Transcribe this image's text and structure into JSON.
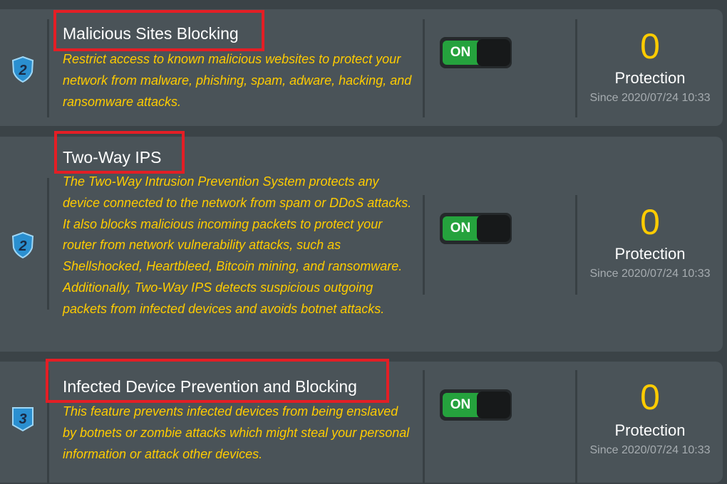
{
  "colors": {
    "card_bg": "#4a5358",
    "page_bg": "#3b4347",
    "title": "#ffffff",
    "description": "#ffcc00",
    "count": "#ffcc00",
    "toggle_on": "#25a23d",
    "highlight_box": "#e41e25",
    "since": "#a6acb0"
  },
  "features": [
    {
      "badge": "2",
      "badge_icon": "shield-level-2-icon",
      "title": "Malicious Sites Blocking",
      "description": "Restrict access to known malicious websites to protect your network from malware, phishing, spam, adware, hacking, and ransomware attacks.",
      "toggle_label": "ON",
      "count": "0",
      "count_label": "Protection",
      "since": "Since 2020/07/24 10:33"
    },
    {
      "badge": "2",
      "badge_icon": "shield-level-2-icon",
      "title": "Two-Way IPS",
      "description": "The Two-Way Intrusion Prevention System protects any device connected to the network from spam or DDoS attacks. It also blocks malicious incoming packets to protect your router from network vulnerability attacks, such as Shellshocked, Heartbleed, Bitcoin mining, and ransomware. Additionally, Two-Way IPS detects suspicious outgoing packets from infected devices and avoids botnet attacks.",
      "toggle_label": "ON",
      "count": "0",
      "count_label": "Protection",
      "since": "Since 2020/07/24 10:33"
    },
    {
      "badge": "3",
      "badge_icon": "shield-level-3-icon",
      "title": "Infected Device Prevention and Blocking",
      "description": "This feature prevents infected devices from being enslaved by botnets or zombie attacks which might steal your personal information or attack other devices.",
      "toggle_label": "ON",
      "count": "0",
      "count_label": "Protection",
      "since": "Since 2020/07/24 10:33"
    }
  ]
}
